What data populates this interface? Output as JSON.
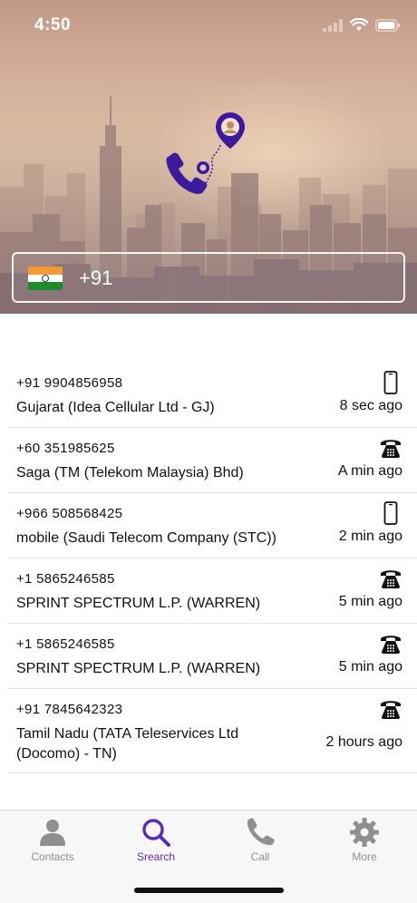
{
  "status_bar": {
    "time": "4:50"
  },
  "search": {
    "country_code": "+91",
    "country_flag": "india-flag-icon"
  },
  "history": [
    {
      "number": "+91 9904856958",
      "carrier": "Gujarat (Idea Cellular Ltd - GJ)",
      "time": "8 sec ago",
      "type_icon": "mobile-phone-icon"
    },
    {
      "number": "+60 351985625",
      "carrier": "Saga (TM (Telekom Malaysia) Bhd)",
      "time": "A min ago",
      "type_icon": "landline-phone-icon"
    },
    {
      "number": "+966 508568425",
      "carrier": "mobile (Saudi Telecom Company (STC))",
      "time": "2 min ago",
      "type_icon": "mobile-phone-icon"
    },
    {
      "number": "+1 5865246585",
      "carrier": "SPRINT SPECTRUM L.P. (WARREN)",
      "time": "5 min ago",
      "type_icon": "landline-phone-icon"
    },
    {
      "number": "+1 5865246585",
      "carrier": "SPRINT SPECTRUM L.P. (WARREN)",
      "time": "5 min ago",
      "type_icon": "landline-phone-icon"
    },
    {
      "number": "+91 7845642323",
      "carrier": "Tamil Nadu (TATA Teleservices Ltd (Docomo) - TN)",
      "time": "2 hours ago",
      "type_icon": "landline-phone-icon"
    }
  ],
  "tabs": [
    {
      "label": "Contacts",
      "icon": "person-icon"
    },
    {
      "label": "Srearch",
      "icon": "search-icon"
    },
    {
      "label": "Call",
      "icon": "phone-icon"
    },
    {
      "label": "More",
      "icon": "gear-icon"
    }
  ],
  "active_tab": "Srearch",
  "colors": {
    "accent": "#5b2bb8",
    "tab_inactive": "#8e8e93",
    "logo": "#3b1a9e"
  }
}
